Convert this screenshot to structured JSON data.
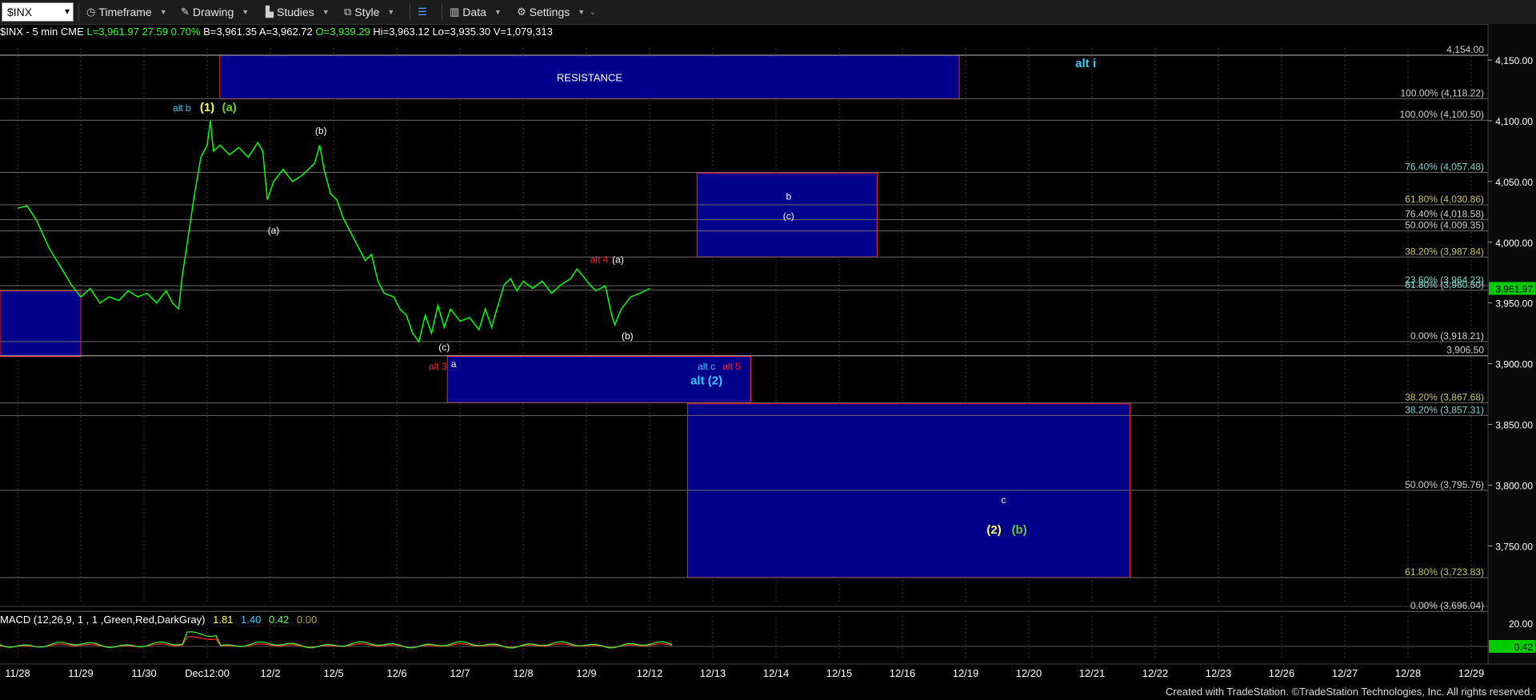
{
  "toolbar": {
    "symbol": "$INX",
    "items": [
      {
        "label": "Timeframe",
        "icon": "clock-icon"
      },
      {
        "label": "Drawing",
        "icon": "drawing-icon"
      },
      {
        "label": "Studies",
        "icon": "studies-icon"
      },
      {
        "label": "Style",
        "icon": "style-icon"
      },
      {
        "label": "",
        "icon": "layout-icon"
      },
      {
        "label": "Data",
        "icon": "data-icon"
      },
      {
        "label": "Settings",
        "icon": "gear-icon"
      }
    ]
  },
  "info": {
    "symbol": "$INX - 5 min  CME",
    "last": "L=3,961.97",
    "change": "27.59",
    "pct": "0.70%",
    "bid": "B=3,961.35",
    "ask": "A=3,962.72",
    "open": "O=3,939.29",
    "high": "Hi=3,963.12",
    "low": "Lo=3,935.30",
    "vol": "V=1,079,313"
  },
  "macd": {
    "label": "MACD (12,26,9, 1 , 1 ,Green,Red,DarkGray)",
    "v1": "1.81",
    "v2": "1.40",
    "v3": "0.42",
    "v4": "0.00",
    "axis_top": "20.00",
    "axis_last": "0.42"
  },
  "footer": "Created with TradeStation. ©TradeStation Technologies, Inc. All rights reserved.",
  "colors": {
    "price": "#00ff00",
    "box_fill": "#00008b",
    "box_border": "#ff2020",
    "wave_yellow": "#ffff55",
    "wave_green": "#66cc33",
    "wave_cyan": "#33ccff",
    "wave_red": "#ff2020",
    "wave_white": "#ffffff"
  },
  "chart_data": {
    "type": "line",
    "y_ticks": [
      4150,
      4100,
      4050,
      4000,
      3950,
      3900,
      3850,
      3800,
      3750
    ],
    "y_tick_labels": [
      "4,150.00",
      "4,100.00",
      "4,050.00",
      "4,000.00",
      "3,950.00",
      "3,900.00",
      "3,850.00",
      "3,800.00",
      "3,750.00"
    ],
    "x_tick_labels": [
      "11/28",
      "11/29",
      "11/30",
      "Dec12:00",
      "12/2",
      "12/5",
      "12/6",
      "12/7",
      "12/8",
      "12/9",
      "12/12",
      "12/13",
      "12/14",
      "12/15",
      "12/16",
      "12/19",
      "12/20",
      "12/21",
      "12/22",
      "12/23",
      "12/26",
      "12/27",
      "12/28",
      "12/29"
    ],
    "last_price_label": "3,961.97",
    "price_points": [
      [
        0,
        4028
      ],
      [
        0.15,
        4030
      ],
      [
        0.3,
        4018
      ],
      [
        0.5,
        3995
      ],
      [
        0.7,
        3978
      ],
      [
        0.85,
        3965
      ],
      [
        1.0,
        3955
      ],
      [
        1.15,
        3962
      ],
      [
        1.3,
        3950
      ],
      [
        1.45,
        3955
      ],
      [
        1.6,
        3952
      ],
      [
        1.75,
        3960
      ],
      [
        1.9,
        3955
      ],
      [
        2.05,
        3958
      ],
      [
        2.2,
        3950
      ],
      [
        2.35,
        3960
      ],
      [
        2.45,
        3950
      ],
      [
        2.55,
        3945
      ],
      [
        2.6,
        3970
      ],
      [
        2.7,
        4005
      ],
      [
        2.8,
        4040
      ],
      [
        2.9,
        4070
      ],
      [
        3.0,
        4080
      ],
      [
        3.05,
        4100
      ],
      [
        3.1,
        4075
      ],
      [
        3.2,
        4080
      ],
      [
        3.35,
        4072
      ],
      [
        3.5,
        4078
      ],
      [
        3.65,
        4070
      ],
      [
        3.8,
        4082
      ],
      [
        3.88,
        4075
      ],
      [
        3.95,
        4035
      ],
      [
        4.05,
        4050
      ],
      [
        4.2,
        4060
      ],
      [
        4.35,
        4050
      ],
      [
        4.5,
        4055
      ],
      [
        4.6,
        4060
      ],
      [
        4.7,
        4065
      ],
      [
        4.78,
        4080
      ],
      [
        4.85,
        4060
      ],
      [
        4.95,
        4040
      ],
      [
        5.05,
        4035
      ],
      [
        5.15,
        4020
      ],
      [
        5.25,
        4010
      ],
      [
        5.4,
        3995
      ],
      [
        5.5,
        3985
      ],
      [
        5.6,
        3990
      ],
      [
        5.7,
        3968
      ],
      [
        5.8,
        3958
      ],
      [
        5.95,
        3955
      ],
      [
        6.05,
        3945
      ],
      [
        6.15,
        3940
      ],
      [
        6.25,
        3925
      ],
      [
        6.35,
        3918
      ],
      [
        6.45,
        3940
      ],
      [
        6.55,
        3925
      ],
      [
        6.65,
        3948
      ],
      [
        6.75,
        3930
      ],
      [
        6.85,
        3945
      ],
      [
        7.0,
        3935
      ],
      [
        7.15,
        3938
      ],
      [
        7.3,
        3928
      ],
      [
        7.4,
        3945
      ],
      [
        7.5,
        3930
      ],
      [
        7.6,
        3948
      ],
      [
        7.7,
        3965
      ],
      [
        7.8,
        3970
      ],
      [
        7.9,
        3960
      ],
      [
        8.0,
        3968
      ],
      [
        8.15,
        3962
      ],
      [
        8.3,
        3968
      ],
      [
        8.45,
        3958
      ],
      [
        8.6,
        3965
      ],
      [
        8.75,
        3970
      ],
      [
        8.85,
        3978
      ],
      [
        8.95,
        3972
      ],
      [
        9.05,
        3965
      ],
      [
        9.15,
        3960
      ],
      [
        9.3,
        3964
      ],
      [
        9.4,
        3940
      ],
      [
        9.45,
        3932
      ],
      [
        9.55,
        3945
      ],
      [
        9.7,
        3955
      ],
      [
        9.85,
        3958
      ],
      [
        10.0,
        3962
      ]
    ],
    "levels": [
      {
        "label": "4,154.00",
        "value": 4154.0
      },
      {
        "label": "100.00% (4,118.22)",
        "value": 4118.22
      },
      {
        "label": "100.00% (4,100.50)",
        "value": 4100.5
      },
      {
        "label": "76.40% (4,057.48)",
        "value": 4057.48
      },
      {
        "label": "61.80% (4,030.86)",
        "value": 4030.86
      },
      {
        "label": "76.40% (4,018.58)",
        "value": 4018.58
      },
      {
        "label": "50.00% (4,009.35)",
        "value": 4009.35
      },
      {
        "label": "38.20% (3,987.84)",
        "value": 3987.84
      },
      {
        "label": "23.60% (3,964.23)",
        "value": 3964.23
      },
      {
        "label": "61.80% (3,960.50)",
        "value": 3960.5
      },
      {
        "label": "0.00% (3,918.21)",
        "value": 3918.21
      },
      {
        "label": "3,906.50",
        "value": 3906.5
      },
      {
        "label": "38.20% (3,867.68)",
        "value": 3867.68
      },
      {
        "label": "38.20% (3,857.31)",
        "value": 3857.31
      },
      {
        "label": "50.00% (3,795.76)",
        "value": 3795.76
      },
      {
        "label": "61.80% (3,723.83)",
        "value": 3723.83
      },
      {
        "label": "0.00% (3,696.04)",
        "value": 3696.04
      }
    ],
    "zones": [
      {
        "label": "RESISTANCE",
        "x0": 3.2,
        "x1": 14.9,
        "y0": 4118,
        "y1": 4154
      },
      {
        "label": "",
        "x0": -0.3,
        "x1": 1.0,
        "y0": 3906,
        "y1": 3960
      },
      {
        "label": "",
        "x0": 6.8,
        "x1": 11.6,
        "y0": 3868,
        "y1": 3906
      },
      {
        "label": "",
        "x0": 10.75,
        "x1": 13.6,
        "y0": 3988,
        "y1": 4057
      },
      {
        "label": "",
        "x0": 10.6,
        "x1": 17.6,
        "y0": 3724,
        "y1": 3867
      }
    ],
    "annotations": [
      {
        "text": "alt b",
        "x": 2.6,
        "y": 4108,
        "color": "cyan"
      },
      {
        "text": "(1)",
        "x": 3.0,
        "y": 4108,
        "color": "yellow"
      },
      {
        "text": "(a)",
        "x": 3.35,
        "y": 4108,
        "color": "green"
      },
      {
        "text": "(b)",
        "x": 4.8,
        "y": 4089,
        "color": "white"
      },
      {
        "text": "(a)",
        "x": 4.05,
        "y": 4007,
        "color": "white"
      },
      {
        "text": "alt 4",
        "x": 9.2,
        "y": 3983,
        "color": "red"
      },
      {
        "text": "(a)",
        "x": 9.5,
        "y": 3983,
        "color": "white"
      },
      {
        "text": "(c)",
        "x": 6.75,
        "y": 3911,
        "color": "white"
      },
      {
        "text": "(b)",
        "x": 9.65,
        "y": 3920,
        "color": "white"
      },
      {
        "text": "alt 3",
        "x": 6.65,
        "y": 3895,
        "color": "red"
      },
      {
        "text": "a",
        "x": 6.9,
        "y": 3897,
        "color": "white"
      },
      {
        "text": "alt c",
        "x": 10.9,
        "y": 3895,
        "color": "cyan"
      },
      {
        "text": "alt 5",
        "x": 11.3,
        "y": 3895,
        "color": "red"
      },
      {
        "text": "alt (2)",
        "x": 10.9,
        "y": 3883,
        "color": "cyan"
      },
      {
        "text": "b",
        "x": 12.2,
        "y": 4035,
        "color": "white"
      },
      {
        "text": "(c)",
        "x": 12.2,
        "y": 4019,
        "color": "white"
      },
      {
        "text": "alt i",
        "x": 16.9,
        "y": 4144,
        "color": "cyan"
      },
      {
        "text": "c",
        "x": 15.6,
        "y": 3785,
        "color": "white"
      },
      {
        "text": "(2)",
        "x": 15.45,
        "y": 3760,
        "color": "yellow"
      },
      {
        "text": "(b)",
        "x": 15.85,
        "y": 3760,
        "color": "green"
      }
    ]
  }
}
